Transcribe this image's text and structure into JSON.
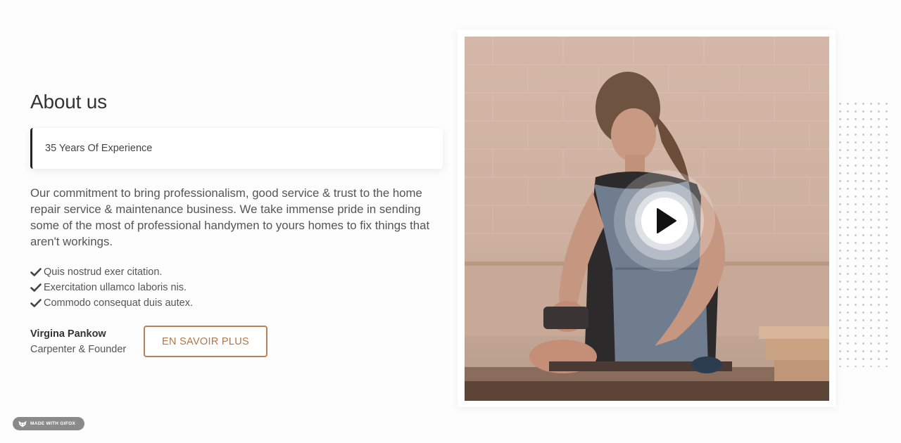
{
  "about": {
    "title": "About us",
    "experience": "35 Years Of Experience",
    "description": "Our commitment to bring professionalism, good service & trust to the home repair service & maintenance business. We take immense pride in sending some of the most of professional handymen to yours homes to fix things that aren't workings.",
    "checklist": [
      "Quis nostrud exer citation.",
      "Exercitation ullamco laboris nis.",
      "Commodo consequat duis autex."
    ],
    "author_name": "Virgina Pankow",
    "author_role": "Carpenter & Founder",
    "cta_label": "EN SAVOIR PLUS"
  },
  "media": {
    "play_icon": "play-icon",
    "photo_subject": "carpenter-woman-planing-wood"
  },
  "badge": {
    "label": "MADE WITH GIFOX",
    "icon": "fox-icon"
  },
  "colors": {
    "accent": "#b9805a",
    "heading": "#333333",
    "text": "#555555",
    "badge_bg": "#8a8a8a"
  }
}
